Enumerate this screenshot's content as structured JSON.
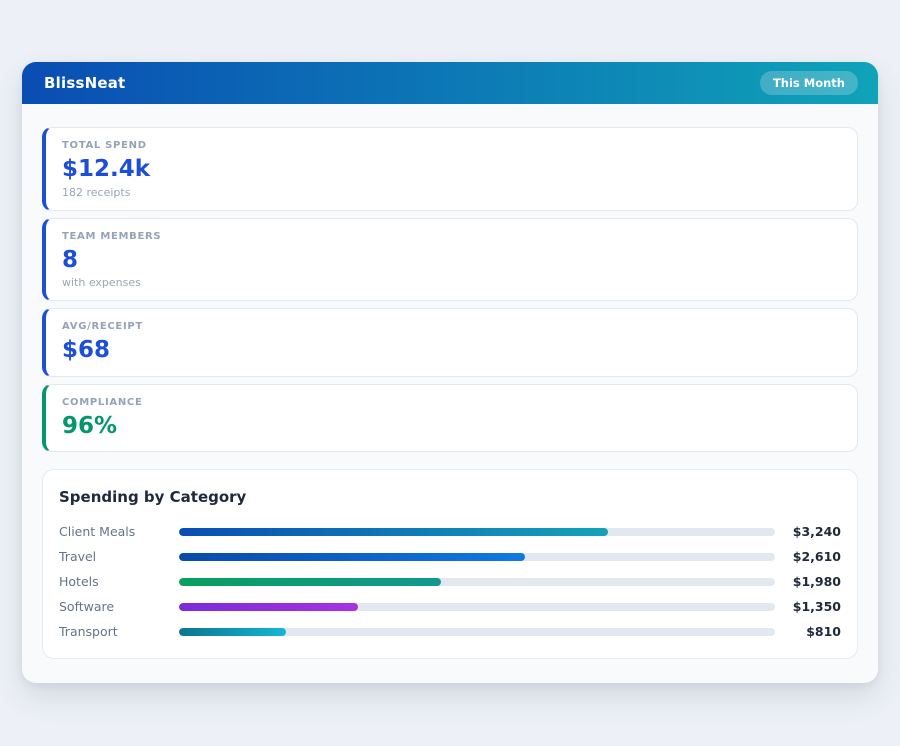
{
  "theme": {
    "page_bg": "#edf1f7",
    "app_bg": "#f8fafc",
    "header_gradient": [
      "#0a4db3",
      "#0fa3b8"
    ],
    "card_border": "#e2e8f0",
    "bar_track": "#e2e8f0",
    "text_dark": "#1e293b",
    "text_muted": "#64748b",
    "label_muted": "#94a3b8",
    "accent_blue": "#1d4ed8",
    "accent_green": "#059669"
  },
  "header": {
    "title": "BlissNeat",
    "period_badge": "This Month"
  },
  "stats": [
    {
      "label": "TOTAL SPEND",
      "value": "$12.4k",
      "sub": "182 receipts",
      "accent": "#1d4ed8"
    },
    {
      "label": "TEAM MEMBERS",
      "value": "8",
      "sub": "with expenses",
      "accent": "#1d4ed8"
    },
    {
      "label": "AVG/RECEIPT",
      "value": "$68",
      "sub": "",
      "accent": "#1d4ed8"
    },
    {
      "label": "COMPLIANCE",
      "value": "96%",
      "sub": "",
      "accent": "#059669"
    }
  ],
  "chart_data": {
    "type": "bar",
    "orientation": "horizontal",
    "title": "Spending by Category",
    "categories": [
      "Client Meals",
      "Travel",
      "Hotels",
      "Software",
      "Transport"
    ],
    "values": [
      3240,
      2610,
      1980,
      1350,
      810
    ],
    "value_labels": [
      "$3,240",
      "$2,610",
      "$1,980",
      "$1,350",
      "$810"
    ],
    "xlim": [
      0,
      4500
    ],
    "grid": false,
    "legend": false,
    "bar_gradients": [
      [
        "#0a4db3",
        "#14a2b8"
      ],
      [
        "#0a4ba8",
        "#1079e0"
      ],
      [
        "#0a9e5f",
        "#12988f"
      ],
      [
        "#7c2bd9",
        "#a832e0"
      ],
      [
        "#0e7490",
        "#12b8d4"
      ]
    ]
  }
}
